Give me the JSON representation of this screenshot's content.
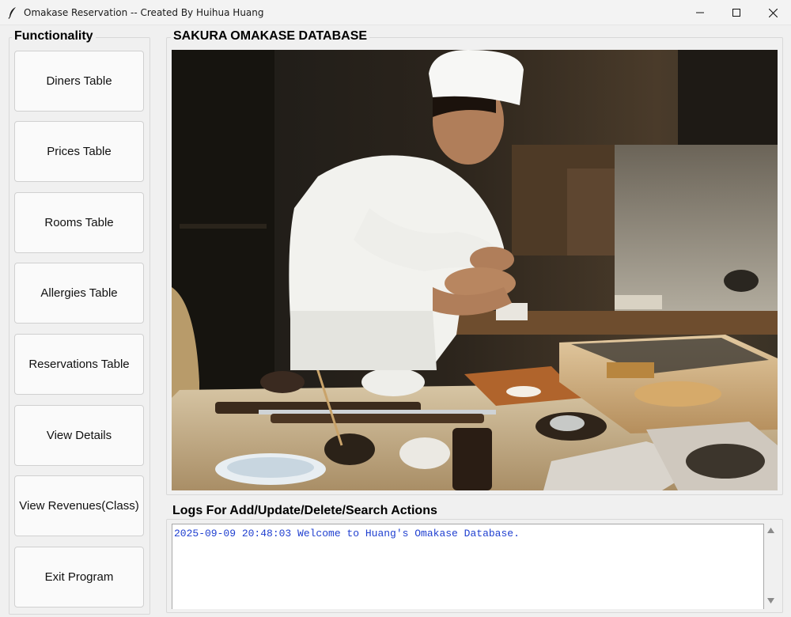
{
  "window": {
    "title": "Omakase Reservation -- Created By Huihua Huang",
    "icon": "feather-icon",
    "controls": [
      "minimize-icon",
      "maximize-icon",
      "close-icon"
    ]
  },
  "functionality": {
    "title": "Functionality",
    "buttons": [
      {
        "label": "Diners Table"
      },
      {
        "label": "Prices Table"
      },
      {
        "label": "Rooms Table"
      },
      {
        "label": "Allergies Table"
      },
      {
        "label": "Reservations Table"
      },
      {
        "label": "View Details"
      },
      {
        "label": "View Revenues(Class)"
      },
      {
        "label": "Exit Program"
      }
    ]
  },
  "database_panel": {
    "title": "SAKURA OMAKASE DATABASE"
  },
  "logs": {
    "title": "Logs For Add/Update/Delete/Search Actions",
    "lines": [
      "2025-09-09 20:48:03 Welcome to Huang's Omakase Database."
    ],
    "text_color": "#1f3fd0"
  },
  "colors": {
    "window_bg": "#f0f0f0",
    "log_text": "#1f3fd0"
  }
}
